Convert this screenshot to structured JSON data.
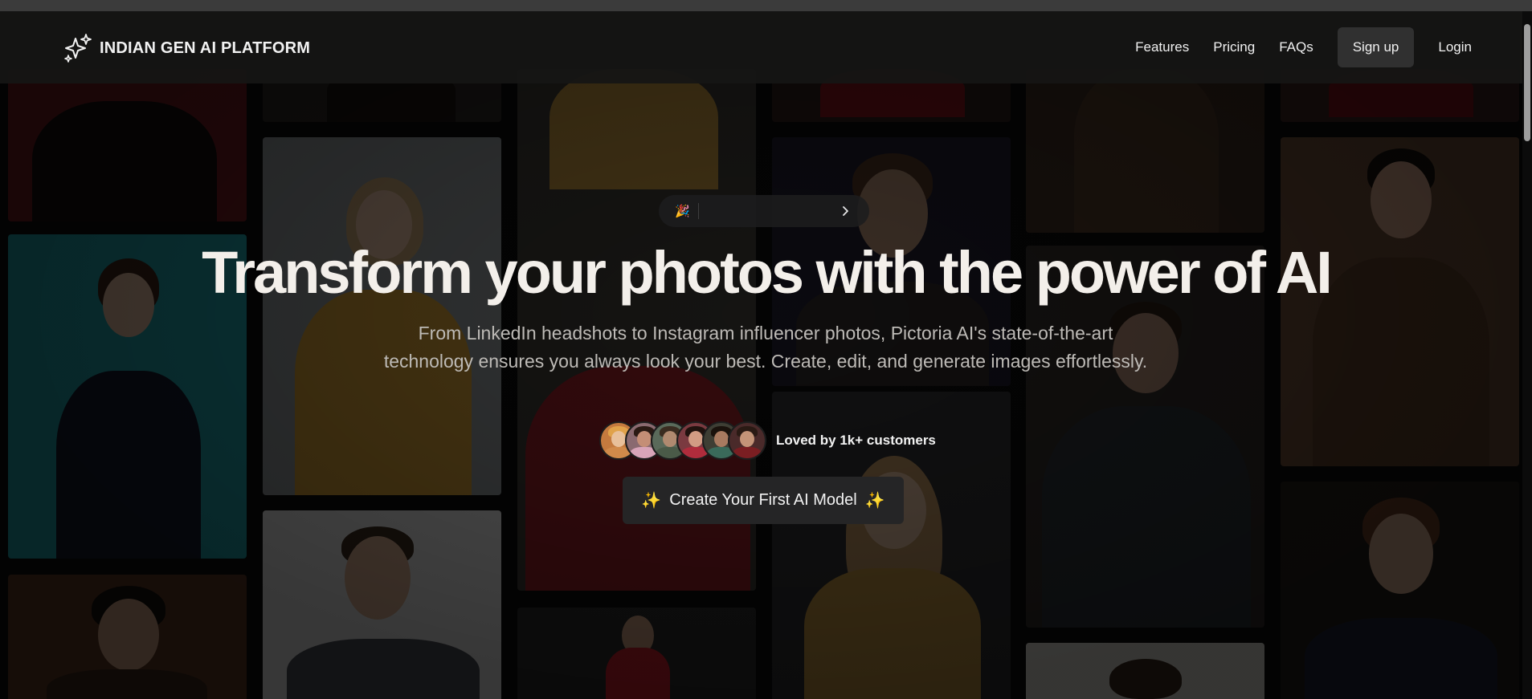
{
  "nav": {
    "brand_text": "INDIAN GEN AI PLATFORM",
    "brand_icon": "sparkles-icon",
    "links": [
      "Features",
      "Pricing",
      "FAQs"
    ],
    "signup_label": "Sign up",
    "login_label": "Login"
  },
  "announcement": {
    "emoji": "🎉",
    "text": "",
    "chevron_icon": "chevron-right-icon"
  },
  "hero": {
    "headline": "Transform your photos with the power of AI",
    "subtext": "From LinkedIn headshots to Instagram influencer photos, Pictoria AI's state-of-the-art technology ensures you always look your best. Create, edit, and generate images effortlessly.",
    "loved_text": "Loved by 1k+ customers",
    "cta_spark": "✨",
    "cta_label": "Create Your First AI Model"
  },
  "colors": {
    "background": "#0b0b0c",
    "nav_bg": "#161514",
    "signup_bg": "#303030",
    "cta_bg": "#252526",
    "headline": "#f3efea",
    "subtext": "#bdbab6"
  }
}
